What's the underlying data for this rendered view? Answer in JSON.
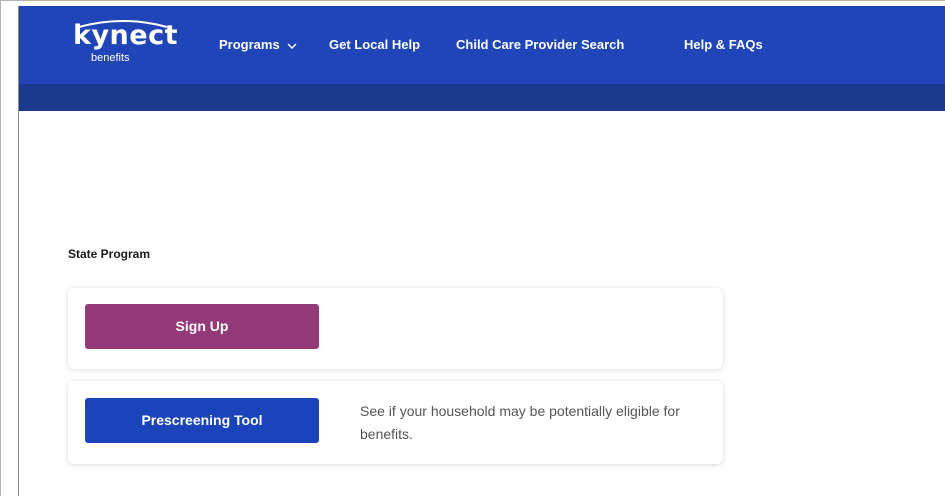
{
  "header": {
    "logo": {
      "wordmark": "kynect",
      "subtitle": "benefits"
    },
    "nav": {
      "programs": "Programs",
      "get_local_help": "Get Local Help",
      "child_care_search": "Child Care Provider Search",
      "help_faqs": "Help & FAQs"
    }
  },
  "main": {
    "section_label": "State Program",
    "signup_card": {
      "button_label": "Sign Up"
    },
    "prescreen_card": {
      "button_label": "Prescreening Tool",
      "description": "See if your household may be potentially eligible for benefits."
    }
  },
  "colors": {
    "nav_bg": "#1f45b8",
    "subbar_bg": "#1b3a8f",
    "signup_button": "#953a79",
    "prescreen_button": "#1b44ba"
  },
  "icons": {
    "programs_dropdown": "chevron-down-icon"
  }
}
